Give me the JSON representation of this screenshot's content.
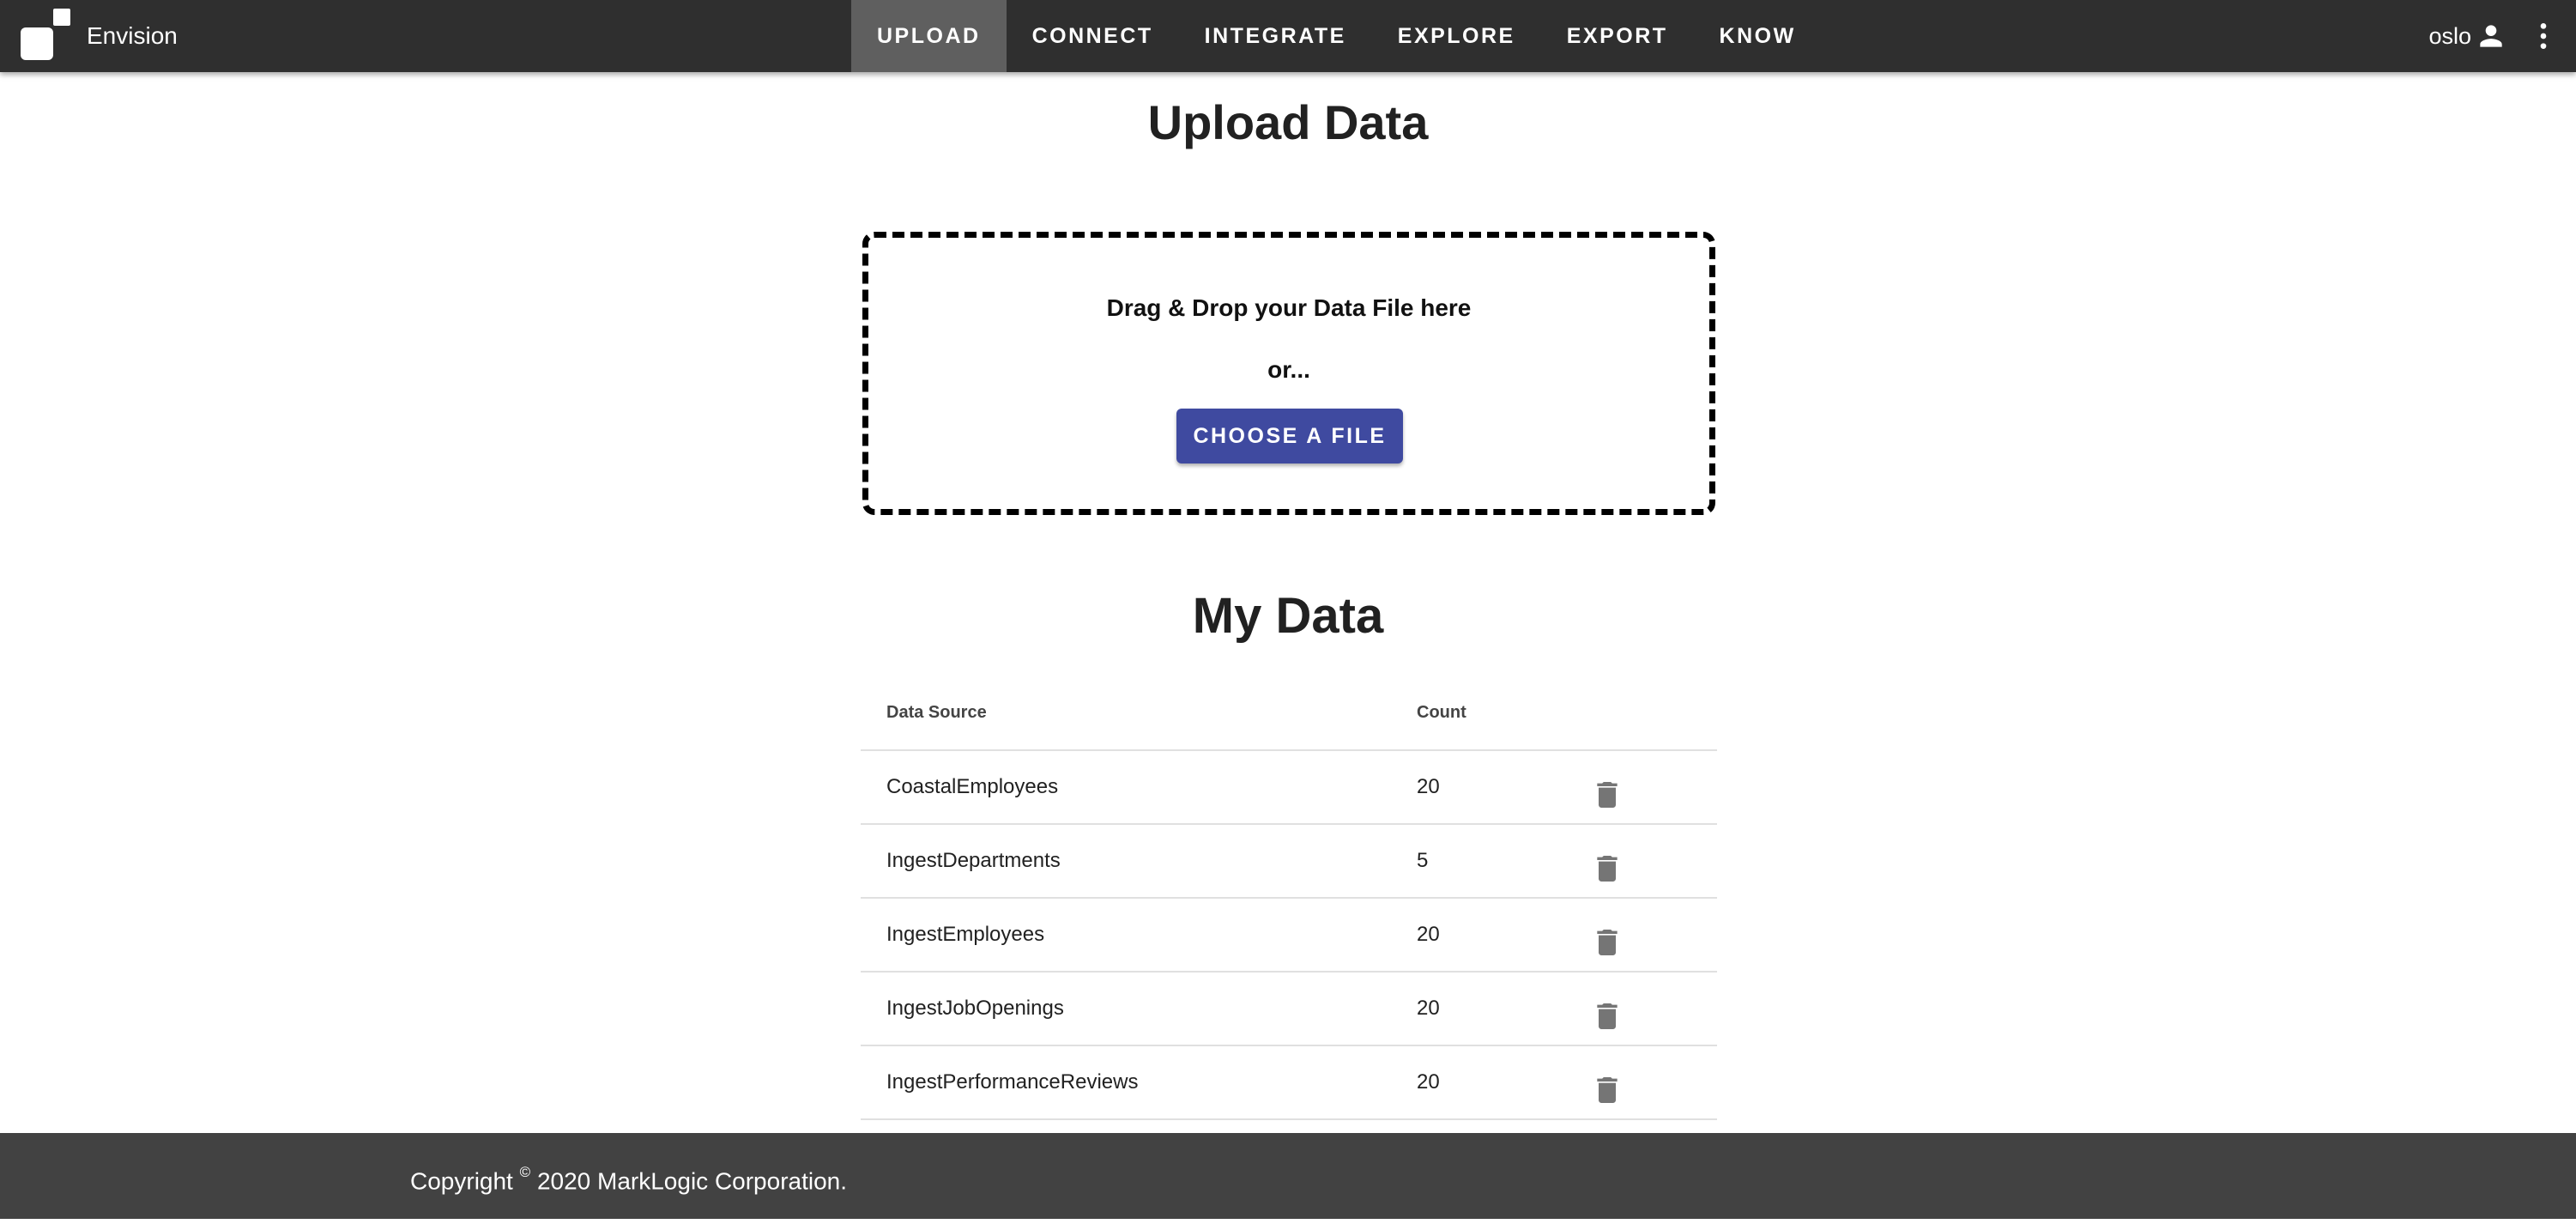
{
  "app": {
    "title": "Envision"
  },
  "nav": {
    "items": [
      {
        "label": "UPLOAD",
        "active": true
      },
      {
        "label": "CONNECT",
        "active": false
      },
      {
        "label": "INTEGRATE",
        "active": false
      },
      {
        "label": "EXPLORE",
        "active": false
      },
      {
        "label": "EXPORT",
        "active": false
      },
      {
        "label": "KNOW",
        "active": false
      }
    ]
  },
  "user": {
    "name": "oslo",
    "icon": "account-icon",
    "menu_icon": "more-vert-icon"
  },
  "upload": {
    "title": "Upload Data",
    "drop_text": "Drag & Drop your Data File here",
    "or_text": "or...",
    "button_label": "CHOOSE A FILE"
  },
  "my_data": {
    "title": "My Data",
    "columns": {
      "source": "Data Source",
      "count": "Count"
    },
    "rows": [
      {
        "source": "CoastalEmployees",
        "count": "20"
      },
      {
        "source": "IngestDepartments",
        "count": "5"
      },
      {
        "source": "IngestEmployees",
        "count": "20"
      },
      {
        "source": "IngestJobOpenings",
        "count": "20"
      },
      {
        "source": "IngestPerformanceReviews",
        "count": "20"
      }
    ],
    "row_action_icon": "delete-icon"
  },
  "footer": {
    "prefix": "Copyright",
    "symbol": "©",
    "text": "2020 MarkLogic Corporation."
  },
  "colors": {
    "appbar": "#2f2f2f",
    "nav_active": "#5f5f5f",
    "primary_button": "#3f4aa0",
    "footer": "#424242",
    "delete_icon": "#757575"
  }
}
